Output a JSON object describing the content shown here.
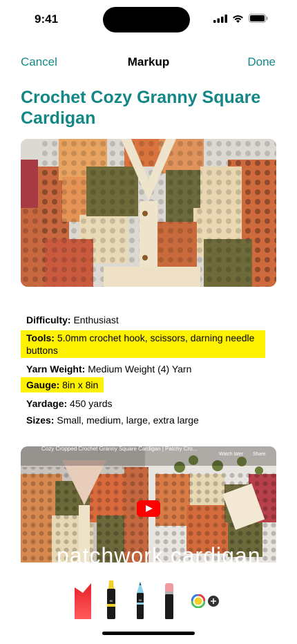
{
  "status_bar": {
    "time": "9:41"
  },
  "nav": {
    "cancel": "Cancel",
    "title": "Markup",
    "done": "Done"
  },
  "document": {
    "title": "Crochet Cozy Granny Square Cardigan",
    "details": [
      {
        "label": "Difficulty:",
        "value": "Enthusiast",
        "highlighted": false
      },
      {
        "label": "Tools:",
        "value": "5.0mm crochet hook, scissors, darning needle buttons",
        "highlighted": true
      },
      {
        "label": "Yarn Weight:",
        "value": "Medium Weight (4) Yarn",
        "highlighted": false
      },
      {
        "label": "Gauge:",
        "value": "8in x 8in",
        "highlighted": true
      },
      {
        "label": "Yardage:",
        "value": "450 yards",
        "highlighted": false
      },
      {
        "label": "Sizes:",
        "value": "Small, medium, large, extra large",
        "highlighted": false
      }
    ]
  },
  "video": {
    "title": "Cozy Cropped Crochet Granny Square Cardigan | Patchy Cro...",
    "watch_later": "Watch later",
    "share": "Share",
    "overlay_text": "patchwork cardigan"
  },
  "toolbar": {
    "tools": [
      "pen",
      "marker",
      "pencil",
      "eraser",
      "color-picker",
      "add"
    ],
    "marker_label": "80",
    "pencil_label": "50"
  },
  "colors": {
    "accent": "#138785",
    "highlight": "#fff200",
    "youtube_red": "#ff0000"
  }
}
